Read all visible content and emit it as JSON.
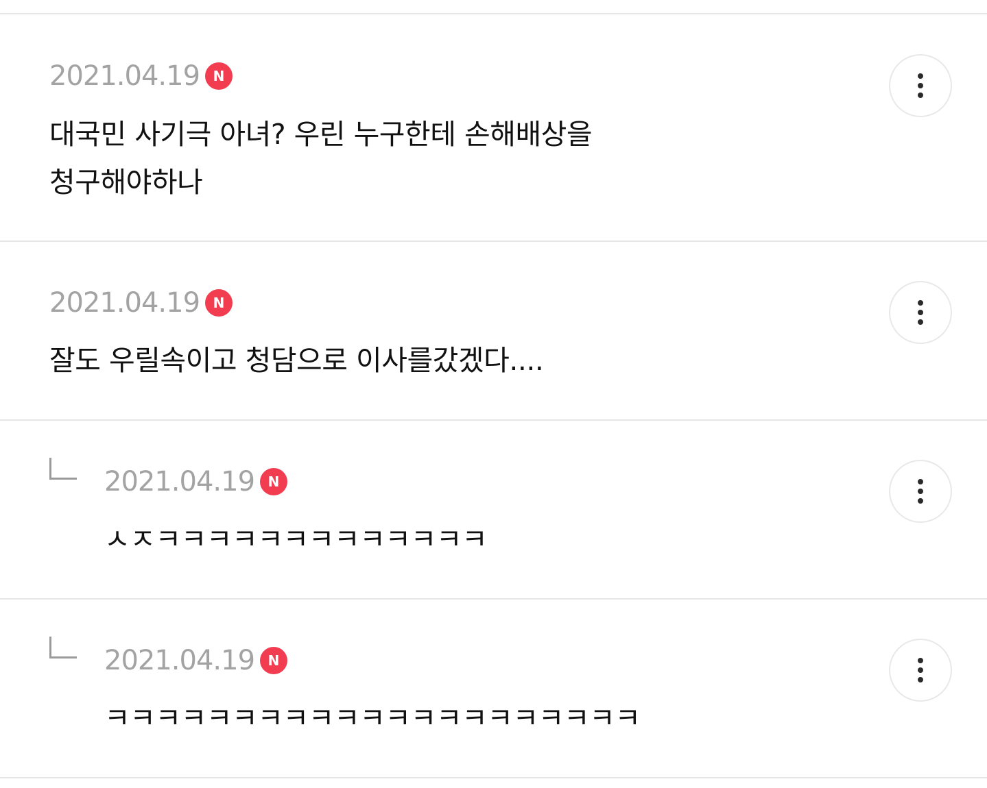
{
  "comments": [
    {
      "date": "2021.04.19",
      "badge": "N",
      "text": "대국민 사기극 아녀? 우린 누구한테 손해배상을\n청구해야하나",
      "is_reply": false
    },
    {
      "date": "2021.04.19",
      "badge": "N",
      "text": "잘도 우릴속이고 청담으로 이사를갔겠다....",
      "is_reply": false
    },
    {
      "date": "2021.04.19",
      "badge": "N",
      "text": "ㅅㅈㅋㅋㅋㅋㅋㅋㅋㅋㅋㅋㅋㅋㅋ",
      "is_reply": true
    },
    {
      "date": "2021.04.19",
      "badge": "N",
      "text": "ㅋㅋㅋㅋㅋㅋㅋㅋㅋㅋㅋㅋㅋㅋㅋㅋㅋㅋㅋㅋㅋ",
      "is_reply": true
    }
  ],
  "icons": {
    "more": "more-vertical-icon",
    "reply": "reply-arrow-icon",
    "new": "new-badge-icon"
  },
  "colors": {
    "badge": "#f23c50",
    "date": "#a3a3a3",
    "divider": "#e6e6e6",
    "text": "#111111"
  }
}
